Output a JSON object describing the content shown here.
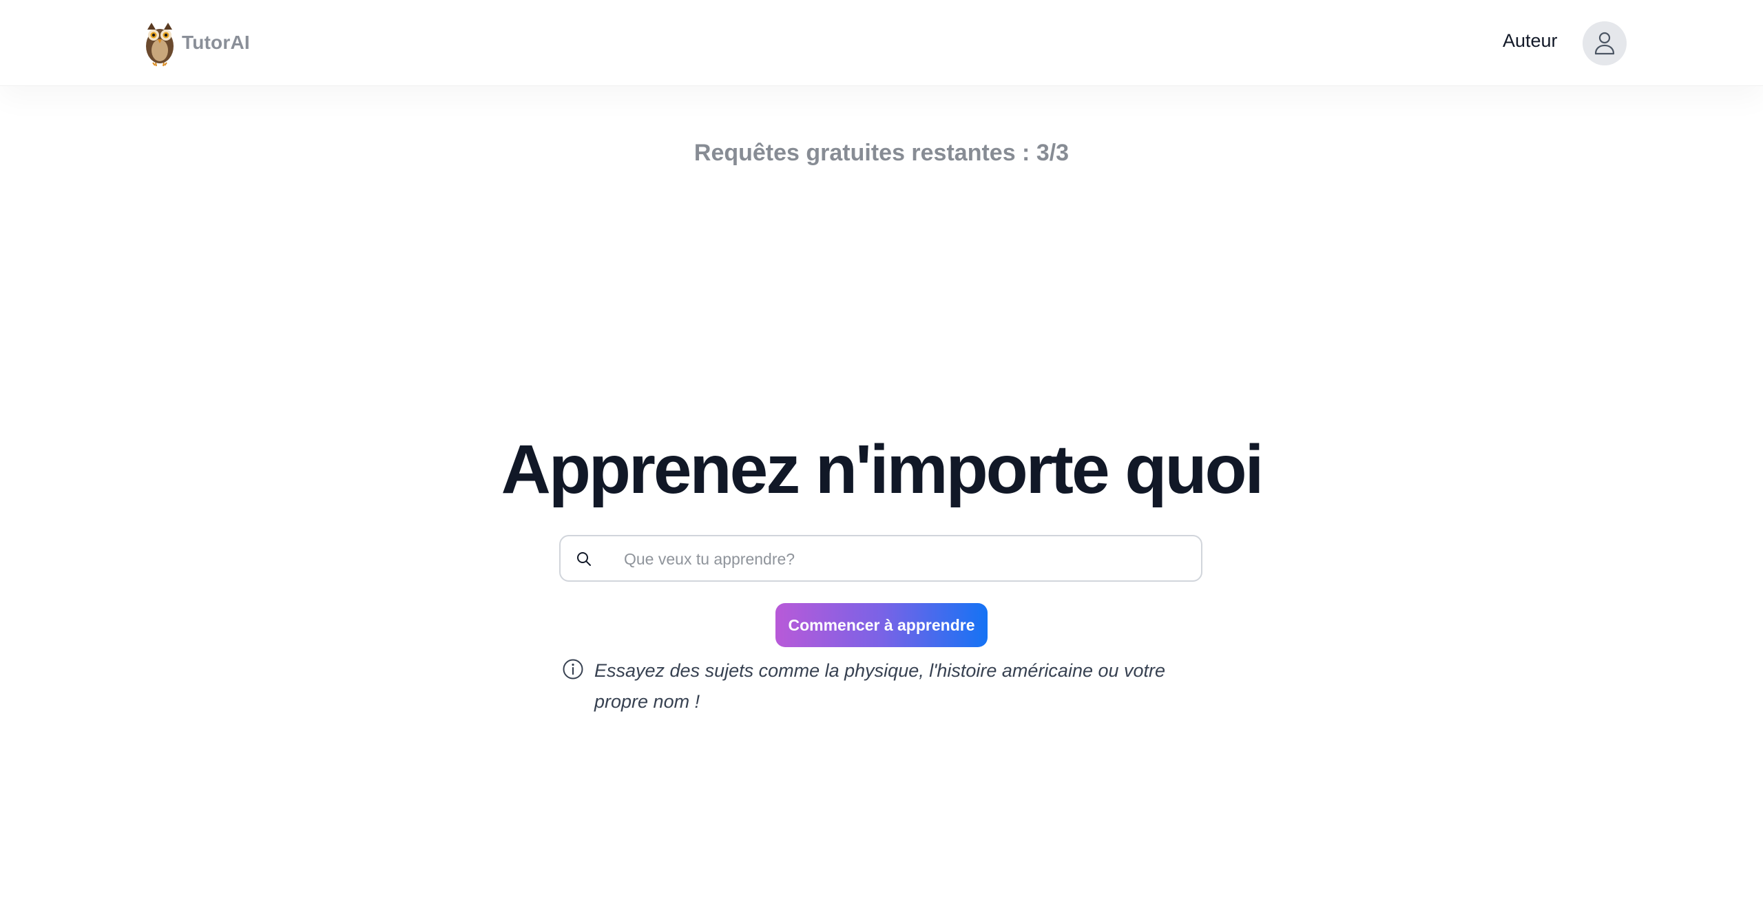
{
  "header": {
    "brand": "TutorAI",
    "logo_icon": "owl-icon",
    "author_link": "Auteur",
    "avatar_icon": "user-icon"
  },
  "quota": {
    "text": "Requêtes gratuites restantes : 3/3"
  },
  "hero": {
    "title": "Apprenez n'importe quoi"
  },
  "search": {
    "placeholder": "Que veux tu apprendre?",
    "value": "",
    "icon": "search-icon"
  },
  "cta": {
    "label": "Commencer à apprendre"
  },
  "hint": {
    "icon": "info-icon",
    "text": "Essayez des sujets comme la physique, l'histoire américaine ou votre propre nom !"
  },
  "colors": {
    "gradient_start": "#b85ad8",
    "gradient_end": "#1573f4",
    "title": "#111827",
    "muted": "#878c94"
  }
}
